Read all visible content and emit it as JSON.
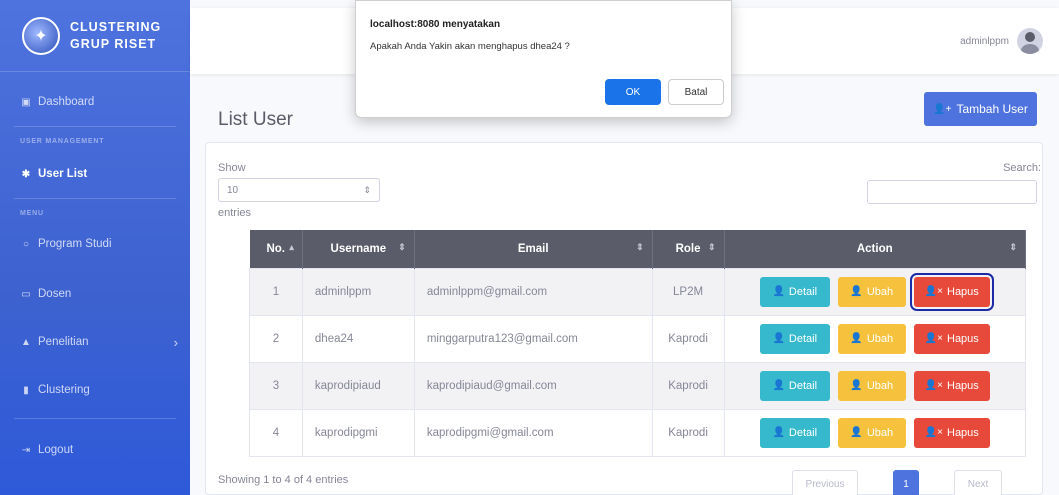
{
  "sidebar": {
    "brand_line1": "CLUSTERING",
    "brand_line2": "GRUP RISET",
    "dashboard": "Dashboard",
    "heading_user_mgmt": "USER MANAGEMENT",
    "user_list": "User List",
    "heading_menu": "MENU",
    "program_studi": "Program Studi",
    "dosen": "Dosen",
    "penelitian": "Penelitian",
    "clustering": "Clustering",
    "logout": "Logout"
  },
  "topbar": {
    "username": "adminlppm"
  },
  "page": {
    "title": "List User",
    "add_button": "Tambah User",
    "show": "Show",
    "length_value": "10",
    "entries": "entries",
    "search": "Search:",
    "showing": "Showing 1 to 4 of 4 entries",
    "previous": "Previous",
    "page_num": "1",
    "next": "Next"
  },
  "table": {
    "headers": [
      "No.",
      "Username",
      "Email",
      "Role",
      "Action"
    ],
    "rows": [
      {
        "no": "1",
        "username": "adminlppm",
        "email": "adminlppm@gmail.com",
        "role": "LP2M"
      },
      {
        "no": "2",
        "username": "dhea24",
        "email": "minggarputra123@gmail.com",
        "role": "Kaprodi"
      },
      {
        "no": "3",
        "username": "kaprodipiaud",
        "email": "kaprodipiaud@gmail.com",
        "role": "Kaprodi"
      },
      {
        "no": "4",
        "username": "kaprodipgmi",
        "email": "kaprodipgmi@gmail.com",
        "role": "Kaprodi"
      }
    ],
    "actions": {
      "detail": "Detail",
      "ubah": "Ubah",
      "hapus": "Hapus"
    }
  },
  "dialog": {
    "title": "localhost:8080 menyatakan",
    "message": "Apakah Anda Yakin akan menghapus dhea24 ?",
    "ok": "OK",
    "cancel": "Batal"
  },
  "colors": {
    "primary": "#4e73df",
    "info": "#36b9cc",
    "warning": "#f6c23e",
    "danger": "#e74a3b"
  }
}
